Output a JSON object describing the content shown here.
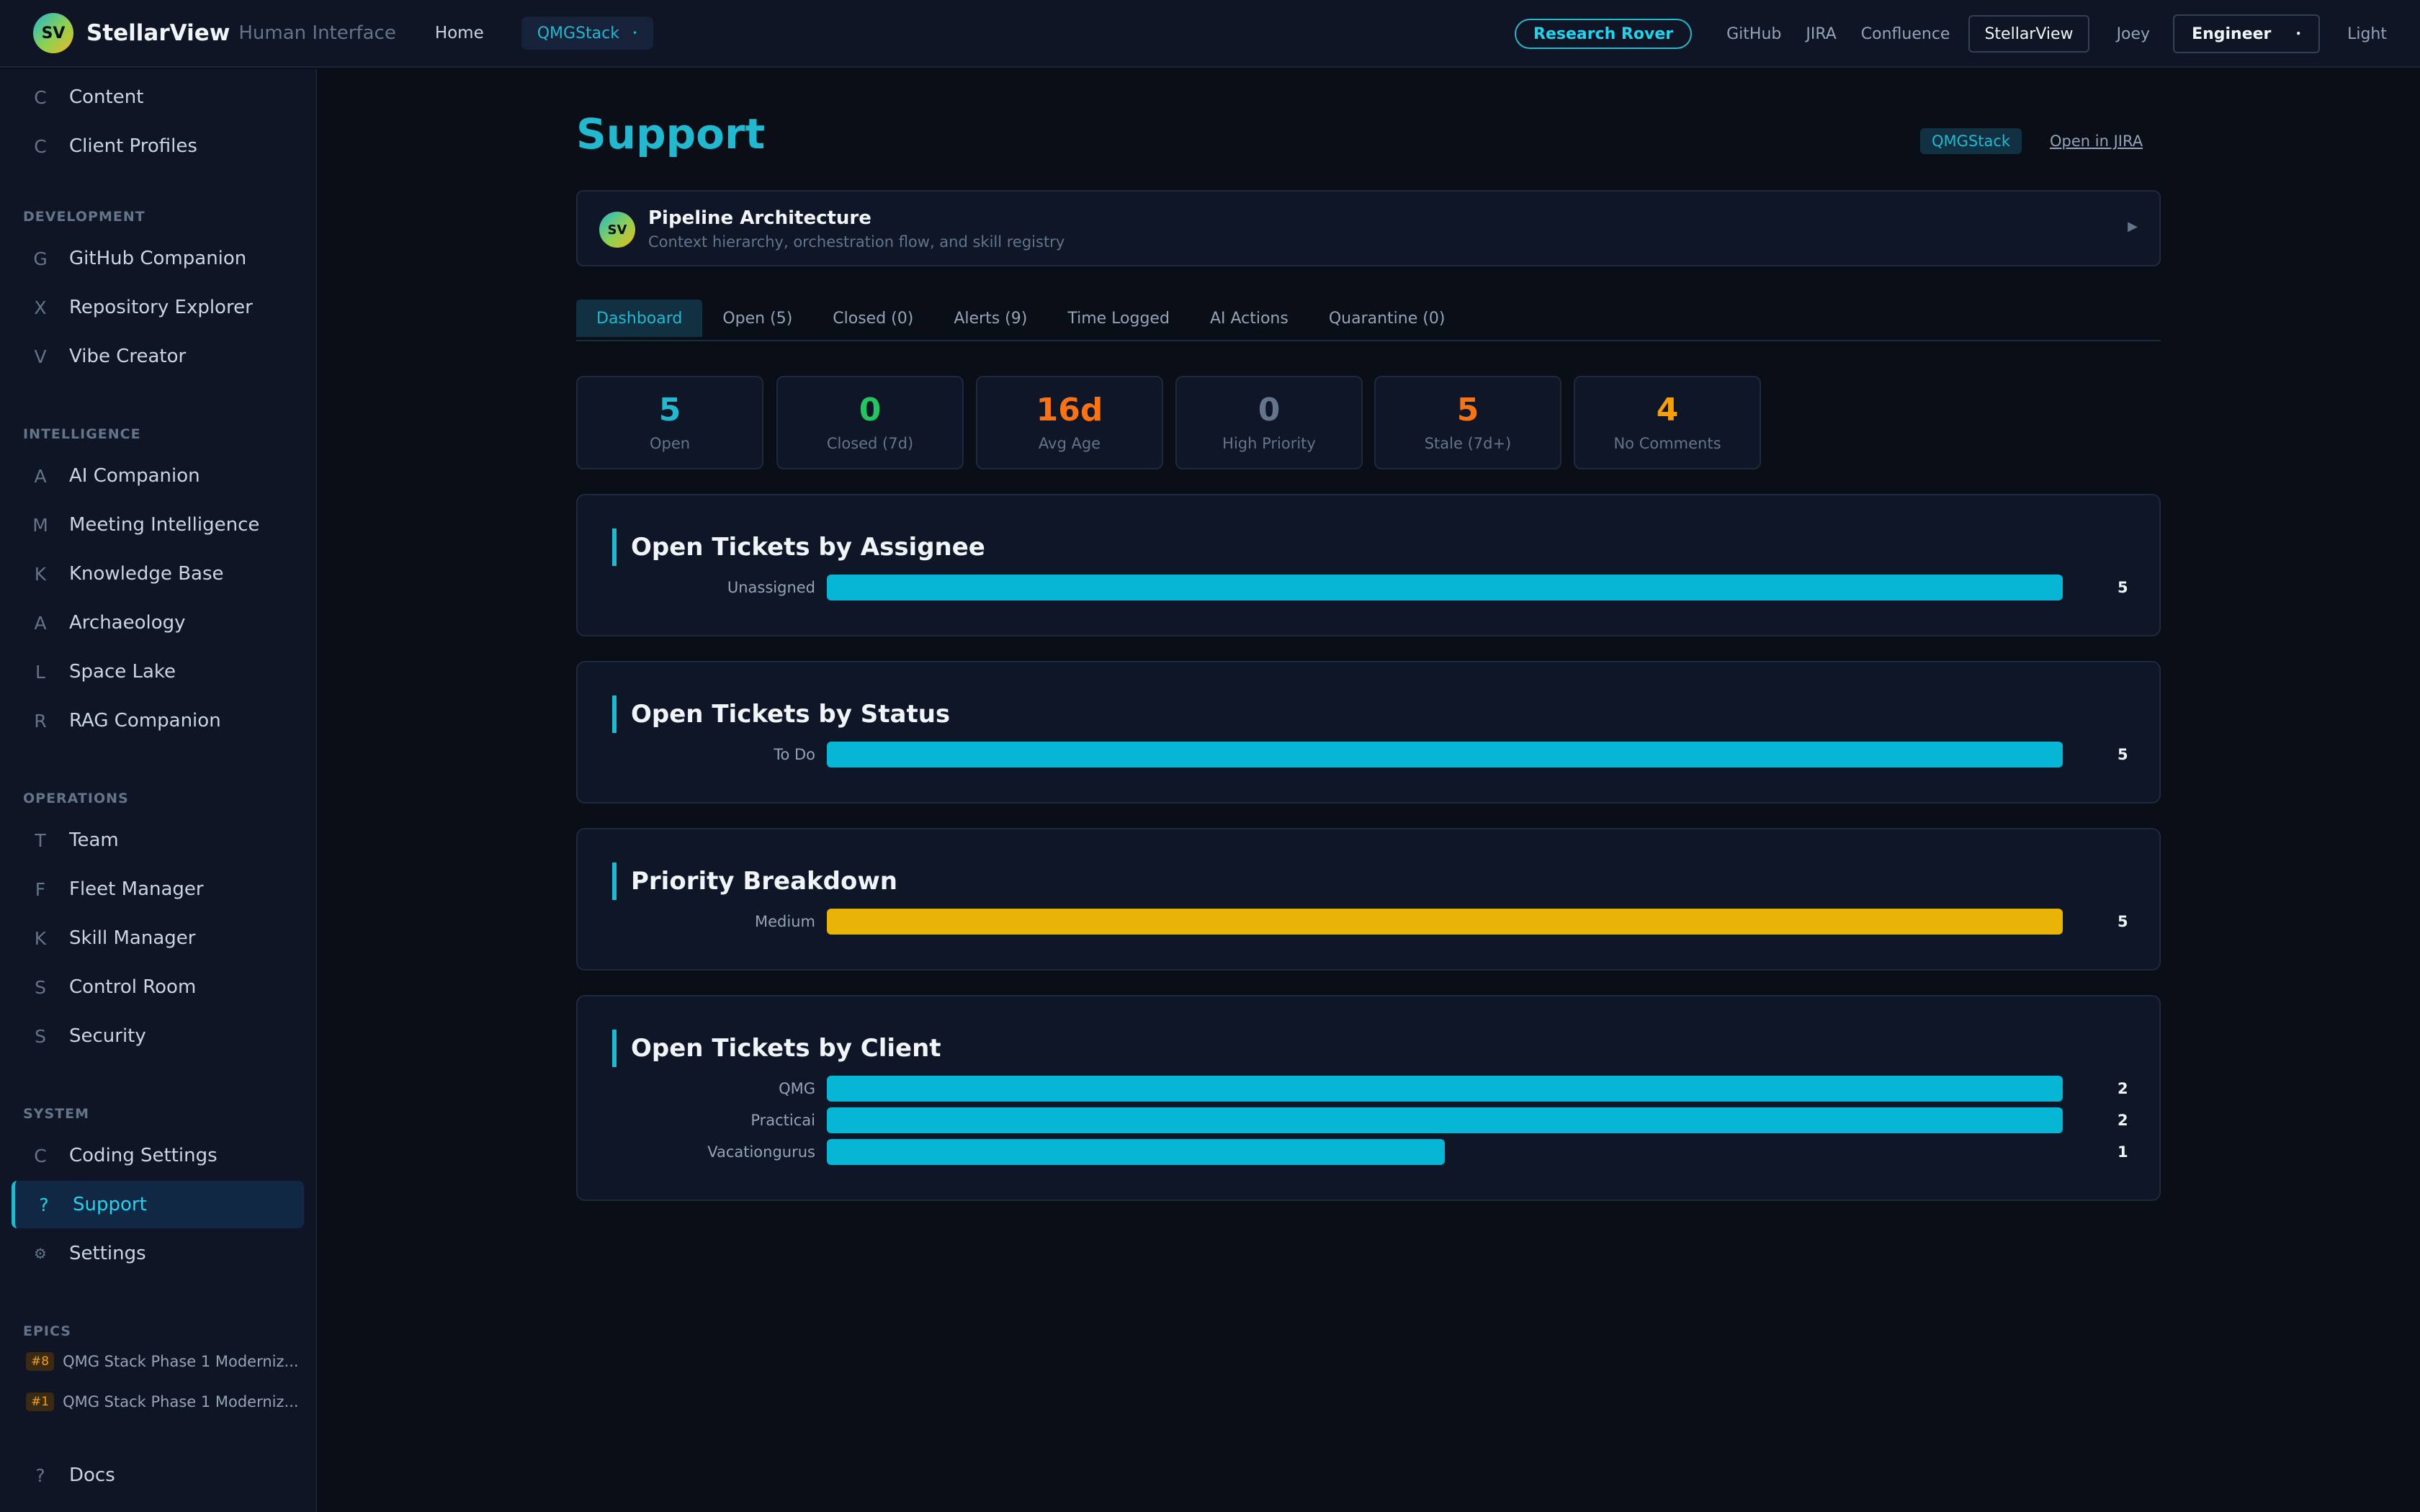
{
  "topbar": {
    "logo_text": "SV",
    "brand_name": "StellarView",
    "brand_sub": "Human Interface",
    "home": "Home",
    "workspace": "QMGStack",
    "research_rover": "Research Rover",
    "links": [
      "GitHub",
      "JIRA",
      "Confluence"
    ],
    "active_app": "StellarView",
    "user": "Joey",
    "role": "Engineer",
    "theme": "Light"
  },
  "sidebar": {
    "top_items": [
      {
        "icon": "C",
        "label": "Content"
      },
      {
        "icon": "C",
        "label": "Client Profiles"
      }
    ],
    "development": {
      "title": "DEVELOPMENT",
      "items": [
        {
          "icon": "G",
          "label": "GitHub Companion"
        },
        {
          "icon": "X",
          "label": "Repository Explorer"
        },
        {
          "icon": "V",
          "label": "Vibe Creator"
        }
      ]
    },
    "intelligence": {
      "title": "INTELLIGENCE",
      "items": [
        {
          "icon": "A",
          "label": "AI Companion"
        },
        {
          "icon": "M",
          "label": "Meeting Intelligence"
        },
        {
          "icon": "K",
          "label": "Knowledge Base"
        },
        {
          "icon": "A",
          "label": "Archaeology"
        },
        {
          "icon": "L",
          "label": "Space Lake"
        },
        {
          "icon": "R",
          "label": "RAG Companion"
        }
      ]
    },
    "operations": {
      "title": "OPERATIONS",
      "items": [
        {
          "icon": "T",
          "label": "Team"
        },
        {
          "icon": "F",
          "label": "Fleet Manager"
        },
        {
          "icon": "K",
          "label": "Skill Manager"
        },
        {
          "icon": "S",
          "label": "Control Room"
        },
        {
          "icon": "S",
          "label": "Security"
        }
      ]
    },
    "system": {
      "title": "SYSTEM",
      "items": [
        {
          "icon": "C",
          "label": "Coding Settings"
        },
        {
          "icon": "?",
          "label": "Support"
        },
        {
          "icon": "⚙",
          "label": "Settings"
        }
      ]
    },
    "epics": {
      "title": "EPICS",
      "items": [
        {
          "tag": "#8",
          "label": "QMG Stack Phase 1 Moderniz..."
        },
        {
          "tag": "#1",
          "label": "QMG Stack Phase 1 Moderniz..."
        }
      ]
    },
    "docs": {
      "icon": "?",
      "label": "Docs"
    }
  },
  "main": {
    "title": "Support",
    "project_pill": "QMGStack",
    "open_jira": "Open in JIRA",
    "pipeline": {
      "logo_text": "SV",
      "title": "Pipeline Architecture",
      "subtitle": "Context hierarchy, orchestration flow, and skill registry",
      "arrow": "▶"
    },
    "tabs": [
      "Dashboard",
      "Open (5)",
      "Closed (0)",
      "Alerts (9)",
      "Time Logged",
      "AI Actions",
      "Quarantine (0)"
    ],
    "stats": [
      {
        "value": "5",
        "label": "Open",
        "color": "#22b8cf"
      },
      {
        "value": "0",
        "label": "Closed (7d)",
        "color": "#22c55e"
      },
      {
        "value": "16d",
        "label": "Avg Age",
        "color": "#f97316"
      },
      {
        "value": "0",
        "label": "High Priority",
        "color": "#64748b"
      },
      {
        "value": "5",
        "label": "Stale (7d+)",
        "color": "#f97316"
      },
      {
        "value": "4",
        "label": "No Comments",
        "color": "#f59e0b"
      }
    ]
  },
  "chart_data": [
    {
      "type": "bar",
      "title": "Open Tickets by Assignee",
      "categories": [
        "Unassigned"
      ],
      "values": [
        5
      ],
      "color": "#06b6d4"
    },
    {
      "type": "bar",
      "title": "Open Tickets by Status",
      "categories": [
        "To Do"
      ],
      "values": [
        5
      ],
      "color": "#06b6d4"
    },
    {
      "type": "bar",
      "title": "Priority Breakdown",
      "categories": [
        "Medium"
      ],
      "values": [
        5
      ],
      "color": "#eab308"
    },
    {
      "type": "bar",
      "title": "Open Tickets by Client",
      "categories": [
        "QMG",
        "Practicai",
        "Vacationgurus"
      ],
      "values": [
        2,
        2,
        1
      ],
      "color": "#06b6d4"
    }
  ]
}
